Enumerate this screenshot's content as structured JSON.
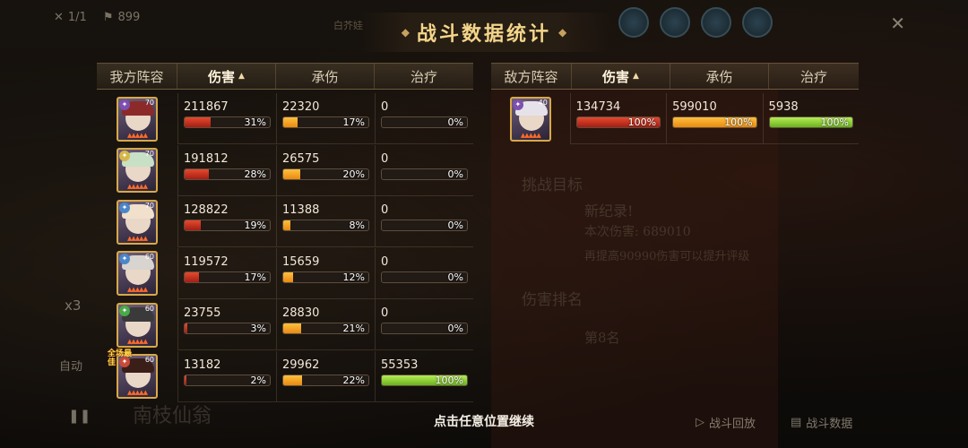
{
  "hud": {
    "round": "1/1",
    "coins": "899",
    "small_label": "白芥娃"
  },
  "title": "战斗数据统计",
  "left_header": {
    "team": "我方阵容",
    "damage": "伤害",
    "taken": "承伤",
    "heal": "治疗"
  },
  "right_header": {
    "team": "敌方阵容",
    "damage": "伤害",
    "taken": "承伤",
    "heal": "治疗"
  },
  "allies": [
    {
      "level": "70",
      "damage": "211867",
      "damage_pct": "31%",
      "damage_frac": 0.31,
      "taken": "22320",
      "taken_pct": "17%",
      "taken_frac": 0.17,
      "heal": "0",
      "heal_pct": "0%",
      "heal_frac": 0,
      "hair": "#8c2a2a",
      "elem": "#7d4fb0"
    },
    {
      "level": "70",
      "damage": "191812",
      "damage_pct": "28%",
      "damage_frac": 0.28,
      "taken": "26575",
      "taken_pct": "20%",
      "taken_frac": 0.2,
      "heal": "0",
      "heal_pct": "0%",
      "heal_frac": 0,
      "hair": "#c8e0c6",
      "elem": "#d6b64a"
    },
    {
      "level": "70",
      "damage": "128822",
      "damage_pct": "19%",
      "damage_frac": 0.19,
      "taken": "11388",
      "taken_pct": "8%",
      "taken_frac": 0.08,
      "heal": "0",
      "heal_pct": "0%",
      "heal_frac": 0,
      "hair": "#f0e0cc",
      "elem": "#4a86c8"
    },
    {
      "level": "60",
      "damage": "119572",
      "damage_pct": "17%",
      "damage_frac": 0.17,
      "taken": "15659",
      "taken_pct": "12%",
      "taken_frac": 0.12,
      "heal": "0",
      "heal_pct": "0%",
      "heal_frac": 0,
      "hair": "#d8d4d0",
      "elem": "#4a86c8"
    },
    {
      "level": "60",
      "damage": "23755",
      "damage_pct": "3%",
      "damage_frac": 0.03,
      "taken": "28830",
      "taken_pct": "21%",
      "taken_frac": 0.21,
      "heal": "0",
      "heal_pct": "0%",
      "heal_frac": 0,
      "hair": "#3a3a3a",
      "elem": "#4aa84a"
    },
    {
      "level": "60",
      "damage": "13182",
      "damage_pct": "2%",
      "damage_frac": 0.02,
      "taken": "29962",
      "taken_pct": "22%",
      "taken_frac": 0.22,
      "heal": "55353",
      "heal_pct": "100%",
      "heal_frac": 1.0,
      "hair": "#3a1e18",
      "elem": "#c94a3a",
      "badge": "全场最佳"
    }
  ],
  "enemies": [
    {
      "level": "40",
      "damage": "134734",
      "damage_pct": "100%",
      "damage_frac": 1.0,
      "taken": "599010",
      "taken_pct": "100%",
      "taken_frac": 1.0,
      "heal": "5938",
      "heal_pct": "100%",
      "heal_frac": 1.0,
      "hair": "#e6e2ea",
      "elem": "#7d4fb0"
    }
  ],
  "footer": "点击任意位置继续",
  "bottom_buttons": {
    "replay": "战斗回放",
    "data": "战斗数据"
  },
  "side": {
    "speed": "x3",
    "auto": "自动"
  },
  "bg": {
    "challenge": "挑战目标",
    "new_record": "新纪录!",
    "this_damage": "本次伤害: 689010",
    "hint": "再提高90990伤害可以提升评级",
    "rank_title": "伤害排名",
    "rank": "第8名",
    "boss_name": "南枝仙翁"
  }
}
